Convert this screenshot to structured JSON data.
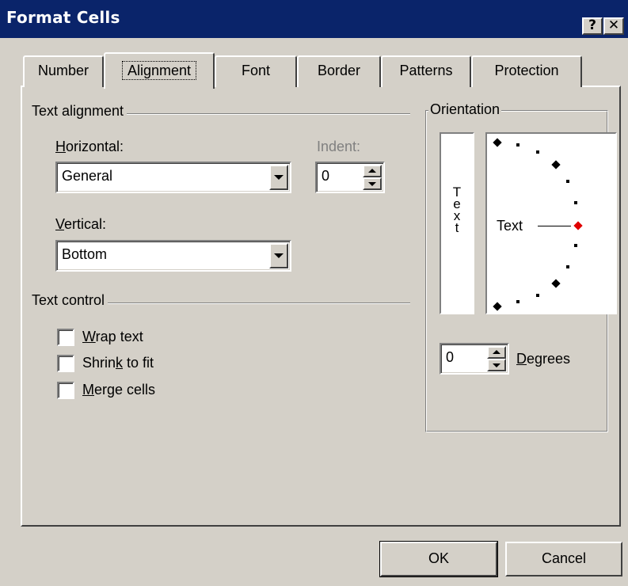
{
  "window": {
    "title": "Format Cells",
    "help_label": "?",
    "close_label": "✕"
  },
  "tabs": [
    {
      "label": "Number"
    },
    {
      "label": "Alignment",
      "active": true
    },
    {
      "label": "Font"
    },
    {
      "label": "Border"
    },
    {
      "label": "Patterns"
    },
    {
      "label": "Protection"
    }
  ],
  "text_alignment": {
    "group_label": "Text alignment",
    "horizontal": {
      "label_mnemonic": "H",
      "label_rest": "orizontal:",
      "value": "General"
    },
    "indent": {
      "label": "Indent:",
      "value": "0"
    },
    "vertical": {
      "label_mnemonic": "V",
      "label_rest": "ertical:",
      "value": "Bottom"
    }
  },
  "text_control": {
    "group_label": "Text control",
    "wrap_text": {
      "pre": "",
      "mnemonic": "W",
      "post": "rap text",
      "checked": false
    },
    "shrink_to_fit": {
      "pre": "Shrin",
      "mnemonic": "k",
      "post": " to fit",
      "checked": false
    },
    "merge_cells": {
      "pre": "",
      "mnemonic": "M",
      "post": "erge cells",
      "checked": false
    }
  },
  "orientation": {
    "group_label": "Orientation",
    "vertical_text": [
      "T",
      "e",
      "x",
      "t"
    ],
    "dial_text": "Text",
    "degrees_value": "0",
    "degrees_label_mnemonic": "D",
    "degrees_label_rest": "egrees"
  },
  "buttons": {
    "ok": "OK",
    "cancel": "Cancel"
  },
  "colors": {
    "title_bar": "#0a246a",
    "face": "#d4d0c8",
    "dial_marker_selected": "#e00000"
  }
}
